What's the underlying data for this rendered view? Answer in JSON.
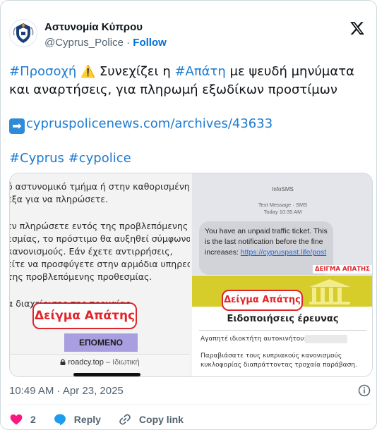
{
  "author": {
    "display_name": "Αστυνομία Κύπρου",
    "handle": "@Cyprus_Police",
    "separator": "·",
    "follow_label": "Follow"
  },
  "tweet": {
    "hashtag_1": "#Προσοχή",
    "warning_emoji": "⚠️",
    "text_1": " Συνεχίζει η ",
    "hashtag_2": "#Απάτη",
    "text_2": " με ψευδή μηνύματα και αναρτήσεις, για πληρωμή εξωδίκων προστίμων",
    "arrow_emoji": "➡",
    "link": "cypruspolicenews.com/archives/43633",
    "hashtag_3": "#Cyprus",
    "hashtag_4": "#cypolice"
  },
  "media": {
    "left": {
      "lines": [
        "ό αστυνομικό τμήμα ή στην καθορισμένη",
        "εξα για να πληρώσετε.",
        "",
        "εν πληρώσετε εντός της προβλεπόμενης",
        "εσμίας, το πρόστιμο θα αυξηθεί σύμφωνα",
        "κανονισμούς. Εάν έχετε αντιρρήσεις,",
        "είτε να προσφύγετε στην αρμόδια υπηρεσία",
        " της προβλεπόμενης προθεσμίας.",
        "",
        "α διαχείρισης της τροχαίας"
      ],
      "sample_label": "Δείγμα Απάτης",
      "next_button": "ΕΠΟΜΕΝΟ",
      "url": "roadcy.top",
      "url_suffix": " – Ιδιωτική"
    },
    "right_top": {
      "sender": "InfoSMS",
      "meta_1": "Text Message · SMS",
      "meta_2": "Today 10:35 AM",
      "message": "You have an unpaid traffic ticket. This is the last notification before the fine increases: ",
      "message_link": "https://cypruspast.life/post",
      "sample_label": "ΔΕΙΓΜΑ ΑΠΑΤΗΣ"
    },
    "right_bottom": {
      "sample_label": "Δείγμα Απάτης",
      "title": "Ειδοποιήσεις έρευνας",
      "owner": "Αγαπητέ ιδιοκτήτη αυτοκινήτου:",
      "body": "Παραβιάσατε τους κυπριακούς κανονισμούς κυκλοφορίας διαπράττοντας τροχαία παράβαση."
    }
  },
  "timestamp": "10:49 AM · Apr 23, 2025",
  "actions": {
    "like_count": "2",
    "reply_label": "Reply",
    "copy_label": "Copy link"
  },
  "colors": {
    "link": "#1d7bd1",
    "like": "#f91880",
    "scam_red": "#e0252b"
  }
}
